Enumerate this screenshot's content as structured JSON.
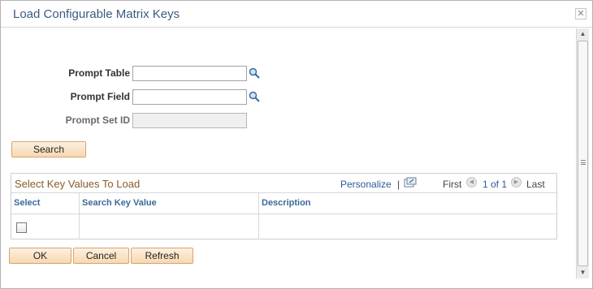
{
  "dialog": {
    "title": "Load Configurable Matrix Keys",
    "close_icon": "close-icon"
  },
  "form": {
    "prompt_table_label": "Prompt Table",
    "prompt_table_value": "",
    "prompt_field_label": "Prompt Field",
    "prompt_field_value": "",
    "prompt_set_id_label": "Prompt Set ID",
    "prompt_set_id_value": "",
    "lookup_icon": "magnifier-icon",
    "search_button": "Search"
  },
  "grid": {
    "title": "Select Key Values To Load",
    "personalize": "Personalize",
    "separator": "|",
    "first": "First",
    "range": "1 of 1",
    "last": "Last",
    "columns": [
      "Select",
      "Search Key Value",
      "Description"
    ],
    "rows": [
      {
        "selected": false,
        "search_key_value": "",
        "description": ""
      }
    ]
  },
  "footer": {
    "ok": "OK",
    "cancel": "Cancel",
    "refresh": "Refresh"
  }
}
